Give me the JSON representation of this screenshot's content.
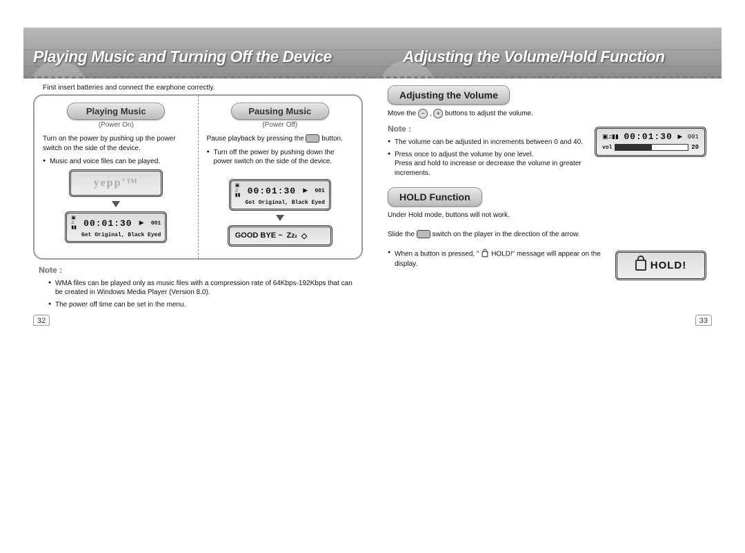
{
  "left": {
    "title": "Playing Music and Turning Off the Device",
    "lead": "First insert batteries and connect the earphone correctly.",
    "play": {
      "heading": "Playing Music",
      "sub": "(Power On)",
      "para": "Turn on the power by pushing up the power switch on the side of the device.",
      "bullet1": "Music and voice files can be played."
    },
    "pause": {
      "heading": "Pausing Music",
      "sub": "(Power Off)",
      "para_before": "Pause playback by pressing the ",
      "para_after": " button.",
      "bullet1": "Turn off the power by pushing down the power switch on the side of the device."
    },
    "yepp": "yepp'™",
    "lcd": {
      "time": "00:01:30",
      "track": "001",
      "info": "Get Original, Black Eyed"
    },
    "goodbye": "GOOD BYE ~",
    "note_label": "Note :",
    "note1": "WMA files can be played only as music files with a compression rate of 64Kbps-192Kbps that can be created in Windows Media Player (Version 8.0).",
    "note2": "The power off time can be set in the menu.",
    "page": "32"
  },
  "right": {
    "title": "Adjusting the Volume/Hold Function",
    "sec1": "Adjusting the Volume",
    "vol_text_before": "Move the ",
    "vol_text_mid": " , ",
    "vol_text_after": " buttons  to adjust the volume.",
    "note_label": "Note :",
    "vol_note1": "The volume can be adjusted in increments between 0 and 40.",
    "vol_note2a": "Press once to adjust the volume by one level.",
    "vol_note2b": "Press and hold to increase or decrease the volume in greater increments.",
    "vol_lcd": {
      "time": "00:01:30",
      "track": "001",
      "vol_label": "vol",
      "vol_value": "20"
    },
    "sec2": "HOLD Function",
    "hold_lead": "Under Hold mode, buttons will not work.",
    "hold_slide_before": "Slide the ",
    "hold_slide_after": " switch on the player in the direction of the arrow.",
    "hold_note_before": "When a button is pressed, \" ",
    "hold_note_mid": " HOLD!\" message will appear on the display.",
    "hold_box": "HOLD!",
    "page": "33",
    "btn_minus": "−",
    "btn_plus": "+"
  }
}
